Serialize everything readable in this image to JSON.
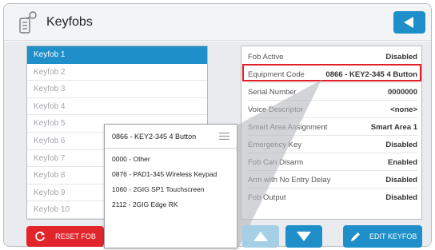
{
  "header": {
    "title": "Keyfobs",
    "icon": "keyfob-icon",
    "back_icon": "back-arrow-icon"
  },
  "keyfob_list": {
    "selected_index": 0,
    "items": [
      "Keyfob 1",
      "Keyfob 2",
      "Keyfob 3",
      "Keyfob 4",
      "Keyfob 5",
      "Keyfob 6",
      "Keyfob 7",
      "Keyfob 8",
      "Keyfob 9",
      "Keyfob 10"
    ]
  },
  "properties": [
    {
      "key": "Fob Active",
      "value": "Disabled"
    },
    {
      "key": "Equipment Code",
      "value": "0866 - KEY2-345 4 Button"
    },
    {
      "key": "Serial Number",
      "value": "0000000"
    },
    {
      "key": "Voice Descriptor",
      "value": "<none>"
    },
    {
      "key": "Smart Area Assignment",
      "value": "Smart Area 1"
    },
    {
      "key": "Emergency Key",
      "value": "Disabled"
    },
    {
      "key": "Fob Can Disarm",
      "value": "Enabled"
    },
    {
      "key": "Arm with No Entry Delay",
      "value": "Disabled"
    },
    {
      "key": "Fob Output",
      "value": "Disabled"
    }
  ],
  "equipment_popup": {
    "selected": "0866 - KEY2-345 4 Button",
    "options": [
      "0000 - Other",
      "0876 - PAD1-345 Wireless Keypad",
      "1060 - 2GIG SP1 Touchscreen",
      "2112 - 2GIG Edge RK"
    ]
  },
  "buttons": {
    "reset": "RESET FOB",
    "edit": "EDIT KEYFOB"
  },
  "colors": {
    "accent": "#1e8fc9",
    "danger": "#e2242b",
    "highlight": "#e01f26"
  }
}
